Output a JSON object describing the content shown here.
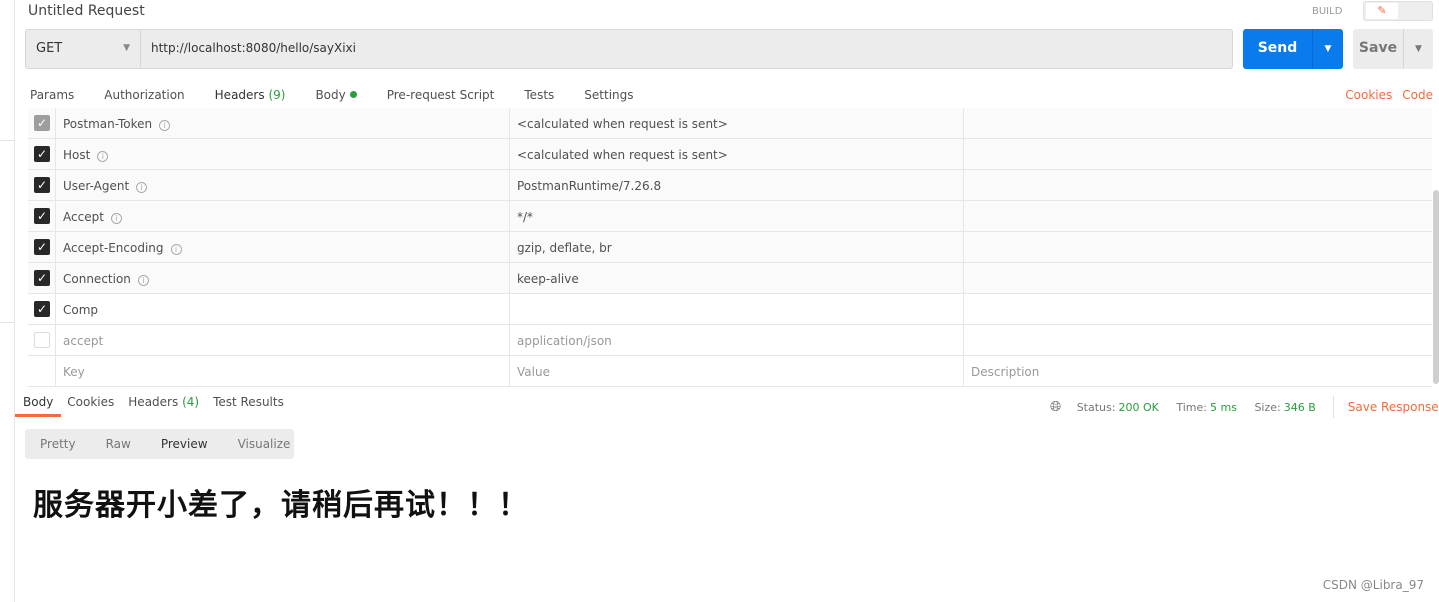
{
  "window": {
    "title": "Untitled Request",
    "build_label": "BUILD",
    "edit_icon": "pencil-icon",
    "comment_icon": "comment-icon"
  },
  "request": {
    "method": "GET",
    "url": "http://localhost:8080/hello/sayXixi",
    "send_label": "Send",
    "save_label": "Save"
  },
  "tabs": [
    {
      "label": "Params"
    },
    {
      "label": "Authorization"
    },
    {
      "label": "Headers",
      "count": "(9)",
      "active": true
    },
    {
      "label": "Body",
      "dot": true
    },
    {
      "label": "Pre-request Script"
    },
    {
      "label": "Tests"
    },
    {
      "label": "Settings"
    }
  ],
  "links": {
    "cookies": "Cookies",
    "code": "Code"
  },
  "headers": [
    {
      "key": "Postman-Token",
      "value": "<calculated when request is sent>",
      "state": "disabled-checked",
      "info": true
    },
    {
      "key": "Host",
      "value": "<calculated when request is sent>",
      "state": "checked",
      "info": true
    },
    {
      "key": "User-Agent",
      "value": "PostmanRuntime/7.26.8",
      "state": "checked",
      "info": true
    },
    {
      "key": "Accept",
      "value": "*/*",
      "state": "checked",
      "info": true
    },
    {
      "key": "Accept-Encoding",
      "value": "gzip, deflate, br",
      "state": "checked",
      "info": true
    },
    {
      "key": "Connection",
      "value": "keep-alive",
      "state": "checked",
      "info": true
    },
    {
      "key": "Comp",
      "value": "",
      "state": "checked",
      "info": false
    },
    {
      "key": "accept",
      "value": "application/json",
      "state": "unchecked",
      "info": false
    }
  ],
  "placeholders": {
    "key": "Key",
    "value": "Value",
    "description": "Description"
  },
  "response": {
    "tabs": [
      {
        "label": "Body",
        "active": true
      },
      {
        "label": "Cookies"
      },
      {
        "label": "Headers",
        "count": "(4)"
      },
      {
        "label": "Test Results"
      }
    ],
    "status_label": "Status:",
    "status": "200 OK",
    "time_label": "Time:",
    "time": "5 ms",
    "size_label": "Size:",
    "size": "346 B",
    "save_response": "Save Response",
    "views": [
      {
        "label": "Pretty"
      },
      {
        "label": "Raw"
      },
      {
        "label": "Preview",
        "active": true
      },
      {
        "label": "Visualize"
      }
    ],
    "body": "服务器开小差了，请稍后再试！！！"
  },
  "watermark": "CSDN @Libra_97",
  "colors": {
    "accent": "#f26b3a",
    "send": "#097bed",
    "success": "#2a9d3b"
  }
}
